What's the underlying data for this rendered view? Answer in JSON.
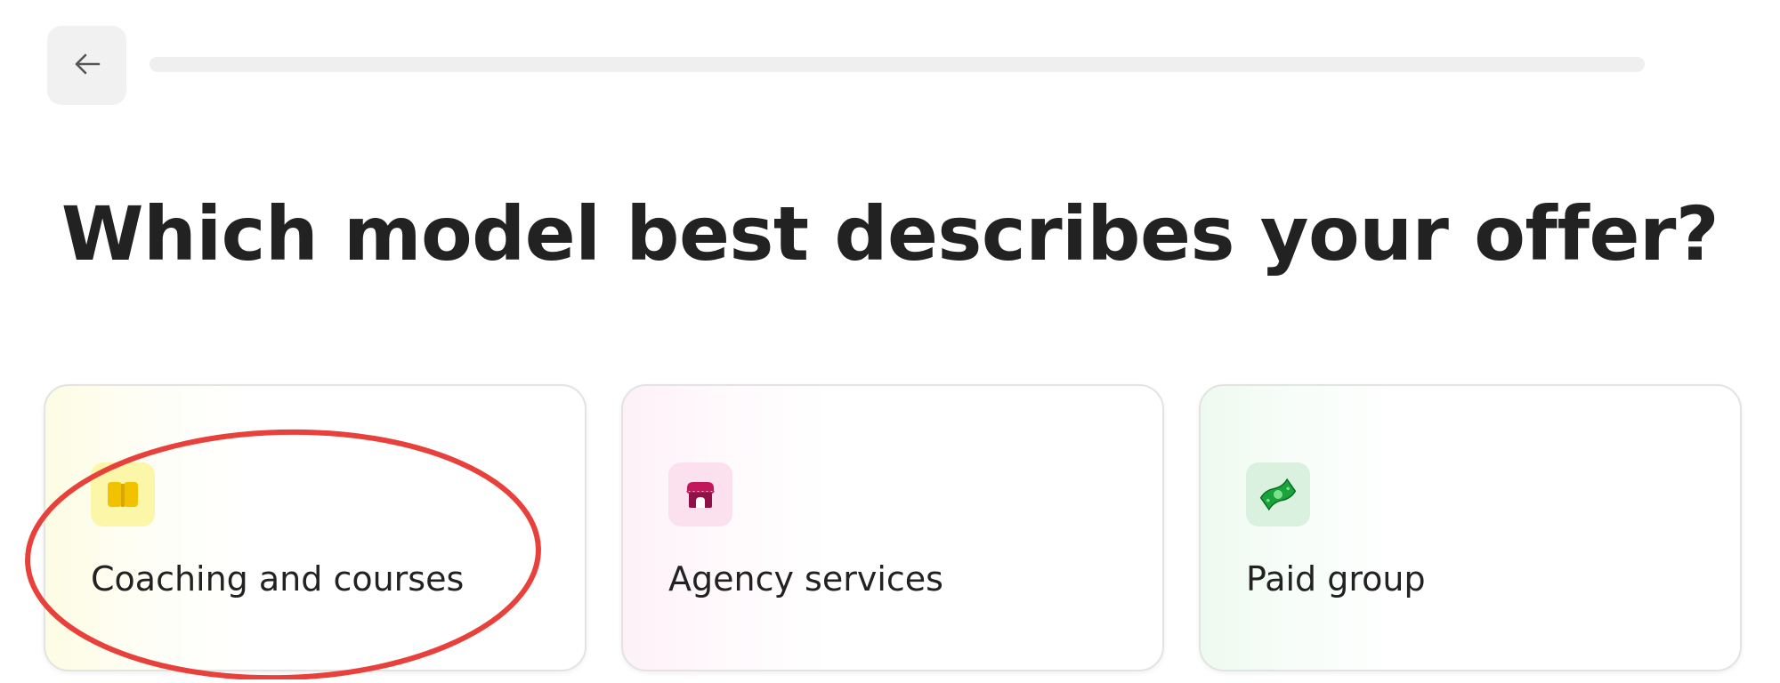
{
  "header": {
    "back_icon": "arrow-left-icon",
    "progress": 0
  },
  "title": "Which model best describes your offer?",
  "options": [
    {
      "label": "Coaching and courses",
      "icon": "book-icon"
    },
    {
      "label": "Agency services",
      "icon": "storefront-icon"
    },
    {
      "label": "Paid group",
      "icon": "money-icon"
    }
  ],
  "colors": {
    "annotation": "#e8403a",
    "title": "#222222"
  }
}
